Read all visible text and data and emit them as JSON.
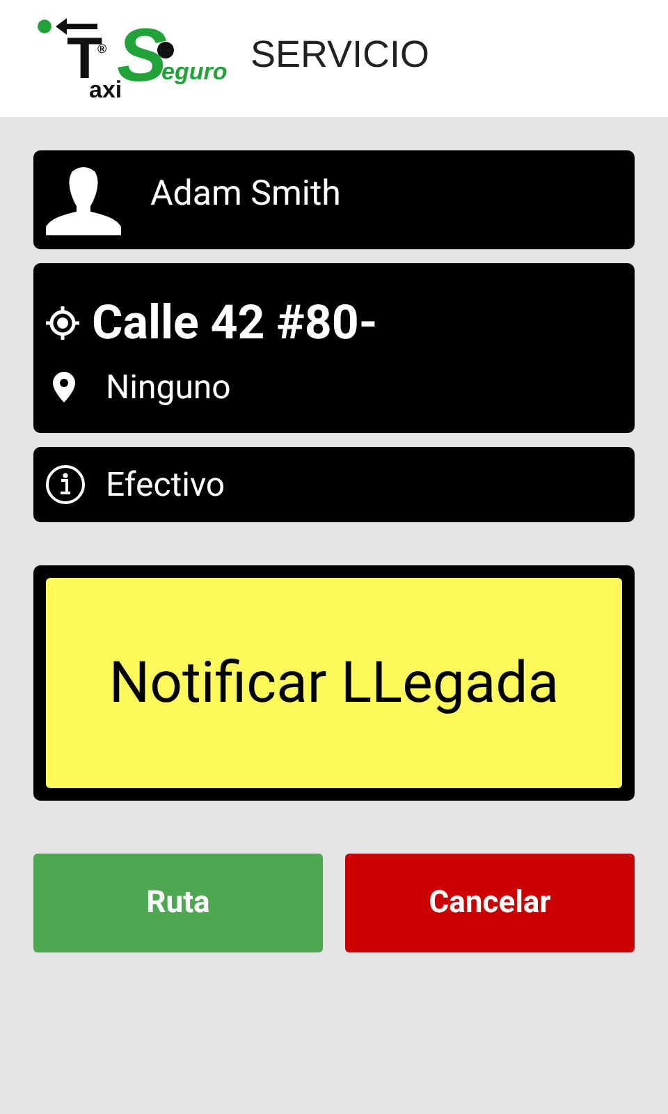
{
  "header": {
    "logo": {
      "letter_t": "T",
      "taxi_rest": "axi",
      "letter_s": "S",
      "seguro_rest": "eguro",
      "mark": "®"
    },
    "title": "SERVICIO"
  },
  "passenger": {
    "name": "Adam Smith"
  },
  "trip": {
    "origin": "Calle 42 #80-",
    "destination": "Ninguno"
  },
  "payment": {
    "method": "Efectivo"
  },
  "notify_button": {
    "label": "Notificar LLegada"
  },
  "buttons": [
    {
      "label": "Ruta",
      "kind": "route"
    },
    {
      "label": "Cancelar",
      "kind": "cancel"
    }
  ]
}
